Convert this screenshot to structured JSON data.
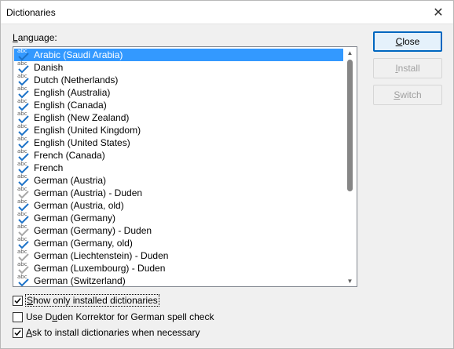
{
  "window": {
    "title": "Dictionaries",
    "close_glyph": "✕"
  },
  "language_label": {
    "before": "",
    "accel": "L",
    "after": "anguage:"
  },
  "languages": [
    {
      "label": "Arabic (Saudi Arabia)",
      "selected": true,
      "icon": "installed-check"
    },
    {
      "label": "Danish",
      "selected": false,
      "icon": "installed-check"
    },
    {
      "label": "Dutch (Netherlands)",
      "selected": false,
      "icon": "installed-check"
    },
    {
      "label": "English (Australia)",
      "selected": false,
      "icon": "installed-check"
    },
    {
      "label": "English (Canada)",
      "selected": false,
      "icon": "installed-check"
    },
    {
      "label": "English (New Zealand)",
      "selected": false,
      "icon": "installed-check"
    },
    {
      "label": "English (United Kingdom)",
      "selected": false,
      "icon": "installed-check"
    },
    {
      "label": "English (United States)",
      "selected": false,
      "icon": "installed-check"
    },
    {
      "label": "French (Canada)",
      "selected": false,
      "icon": "installed-check"
    },
    {
      "label": "French",
      "selected": false,
      "icon": "installed-check"
    },
    {
      "label": "German (Austria)",
      "selected": false,
      "icon": "installed-check"
    },
    {
      "label": "German (Austria) - Duden",
      "selected": false,
      "icon": "gray-check"
    },
    {
      "label": "German (Austria, old)",
      "selected": false,
      "icon": "installed-check"
    },
    {
      "label": "German (Germany)",
      "selected": false,
      "icon": "installed-check"
    },
    {
      "label": "German (Germany) - Duden",
      "selected": false,
      "icon": "gray-check"
    },
    {
      "label": "German (Germany, old)",
      "selected": false,
      "icon": "installed-check"
    },
    {
      "label": "German (Liechtenstein) - Duden",
      "selected": false,
      "icon": "gray-check"
    },
    {
      "label": "German (Luxembourg) - Duden",
      "selected": false,
      "icon": "gray-check"
    },
    {
      "label": "German (Switzerland)",
      "selected": false,
      "icon": "installed-check"
    }
  ],
  "icon_text": "abc",
  "scrollbar": {
    "up_glyph": "▲",
    "down_glyph": "▼"
  },
  "buttons": {
    "close": {
      "before": "",
      "accel": "C",
      "after": "lose",
      "enabled": true
    },
    "install": {
      "before": "",
      "accel": "I",
      "after": "nstall",
      "enabled": false
    },
    "switch": {
      "before": "",
      "accel": "S",
      "after": "witch",
      "enabled": false
    }
  },
  "options": {
    "show_installed": {
      "before": "",
      "accel": "S",
      "after": "how only installed dictionaries",
      "checked": true
    },
    "use_duden": {
      "before": "Use D",
      "accel": "u",
      "after": "den Korrektor for German spell check",
      "checked": false
    },
    "ask_install": {
      "before": "",
      "accel": "A",
      "after": "sk to install dictionaries when necessary",
      "checked": true
    }
  },
  "colors": {
    "selection": "#3399ff",
    "check_blue": "#1e73c8",
    "check_gray": "#a8a8a8",
    "primary_border": "#0067c0"
  }
}
